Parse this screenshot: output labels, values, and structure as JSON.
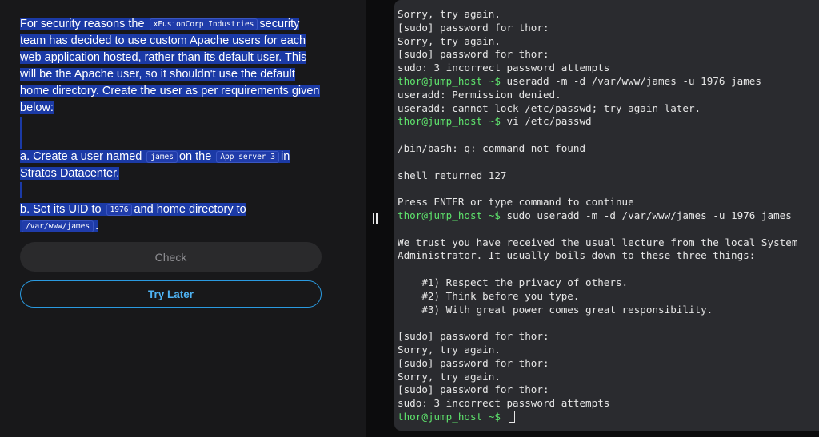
{
  "task": {
    "intro_before": "For security reasons the",
    "intro_code": "xFusionCorp Industries",
    "intro_after": "security team has decided to use custom Apache users for each web application hosted, rather than its default user. This will be the Apache user, so it shouldn't use the default home directory. Create the user as per requirements given below:",
    "req_a_1": "a. Create a user named",
    "req_a_code1": "james",
    "req_a_2": "on the",
    "req_a_code2": "App server 3",
    "req_a_3": "in Stratos Datacenter.",
    "req_b_1": "b. Set its UID to",
    "req_b_code1": "1976",
    "req_b_2": "and home directory to",
    "req_b_code2": "/var/www/james",
    "req_b_3": "."
  },
  "buttons": {
    "check": "Check",
    "try_later": "Try Later"
  },
  "terminal": {
    "prompt": "thor@jump_host ~$",
    "lines": [
      {
        "type": "out",
        "text": "Sorry, try again."
      },
      {
        "type": "out",
        "text": "[sudo] password for thor:"
      },
      {
        "type": "out",
        "text": "Sorry, try again."
      },
      {
        "type": "out",
        "text": "[sudo] password for thor:"
      },
      {
        "type": "out",
        "text": "sudo: 3 incorrect password attempts"
      },
      {
        "type": "cmd",
        "text": " useradd -m -d /var/www/james -u 1976 james"
      },
      {
        "type": "out",
        "text": "useradd: Permission denied."
      },
      {
        "type": "out",
        "text": "useradd: cannot lock /etc/passwd; try again later."
      },
      {
        "type": "cmd",
        "text": " vi /etc/passwd"
      },
      {
        "type": "out",
        "text": ""
      },
      {
        "type": "out",
        "text": "/bin/bash: q: command not found"
      },
      {
        "type": "out",
        "text": ""
      },
      {
        "type": "out",
        "text": "shell returned 127"
      },
      {
        "type": "out",
        "text": ""
      },
      {
        "type": "out",
        "text": "Press ENTER or type command to continue"
      },
      {
        "type": "cmd",
        "text": " sudo useradd -m -d /var/www/james -u 1976 james"
      },
      {
        "type": "out",
        "text": ""
      },
      {
        "type": "out",
        "text": "We trust you have received the usual lecture from the local System"
      },
      {
        "type": "out",
        "text": "Administrator. It usually boils down to these three things:"
      },
      {
        "type": "out",
        "text": ""
      },
      {
        "type": "out",
        "text": "    #1) Respect the privacy of others."
      },
      {
        "type": "out",
        "text": "    #2) Think before you type."
      },
      {
        "type": "out",
        "text": "    #3) With great power comes great responsibility."
      },
      {
        "type": "out",
        "text": ""
      },
      {
        "type": "out",
        "text": "[sudo] password for thor:"
      },
      {
        "type": "out",
        "text": "Sorry, try again."
      },
      {
        "type": "out",
        "text": "[sudo] password for thor:"
      },
      {
        "type": "out",
        "text": "Sorry, try again."
      },
      {
        "type": "out",
        "text": "[sudo] password for thor:"
      },
      {
        "type": "out",
        "text": "sudo: 3 incorrect password attempts"
      },
      {
        "type": "cursor",
        "text": " "
      }
    ]
  },
  "colors": {
    "selection": "#1b3aa6",
    "prompt_green": "#5ee36c",
    "accent_blue": "#2a9ae0"
  }
}
